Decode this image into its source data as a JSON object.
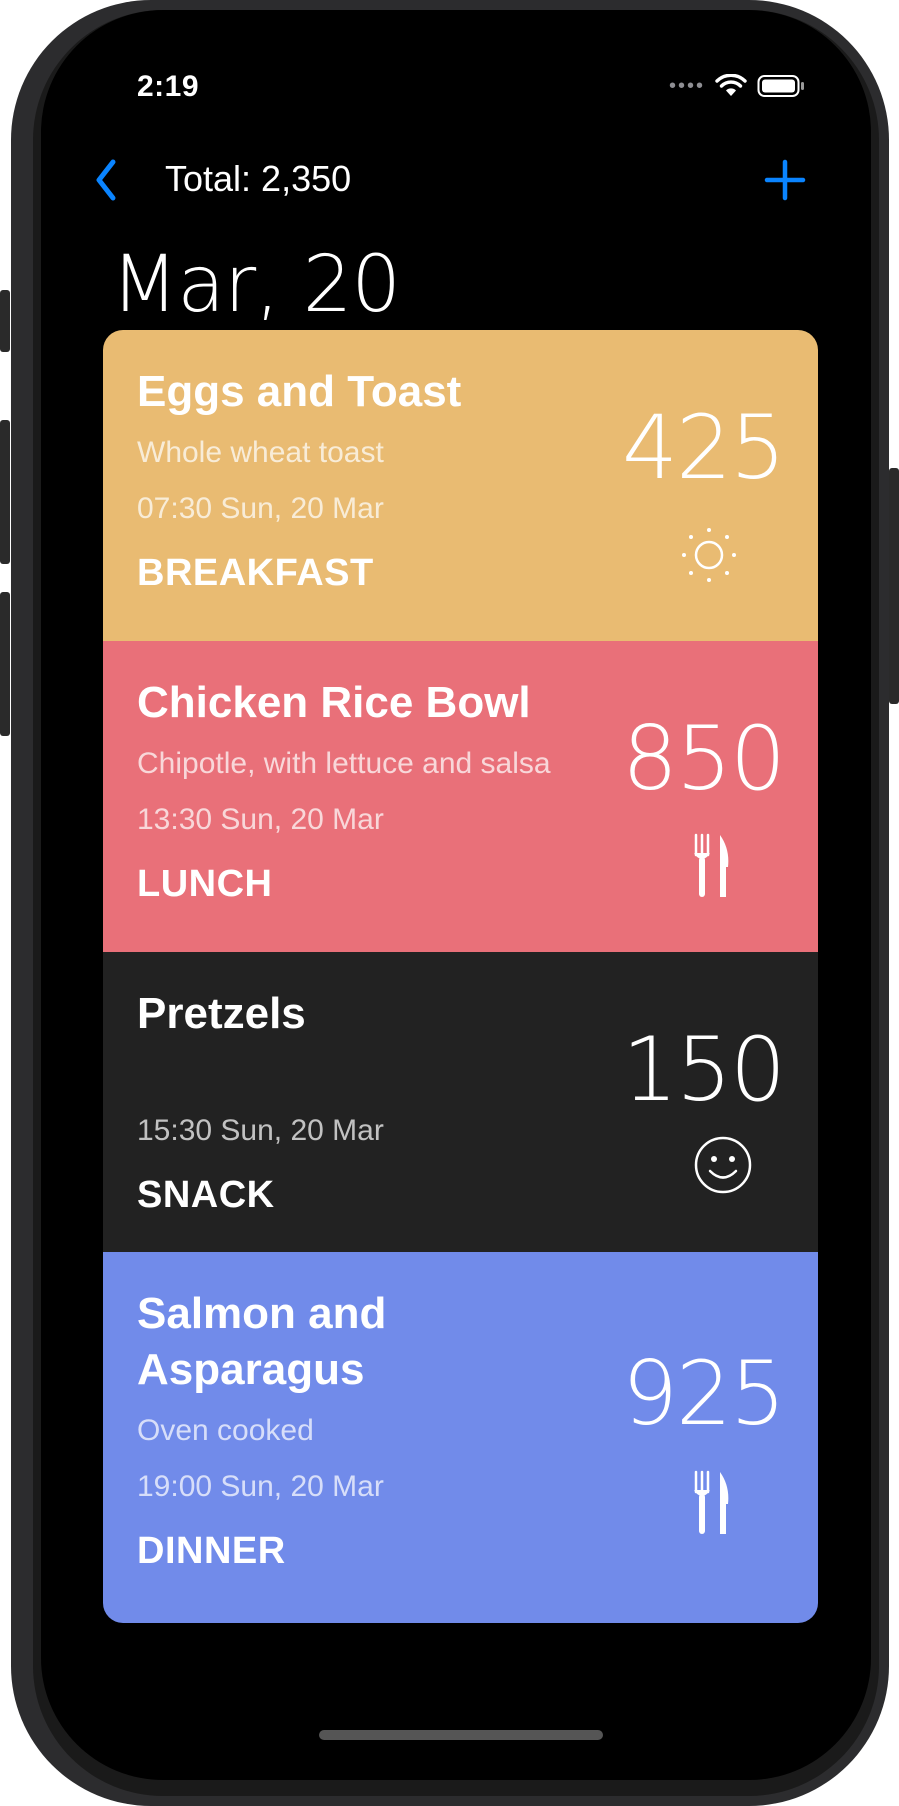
{
  "status": {
    "time": "2:19",
    "signal_dots": "••••"
  },
  "nav": {
    "title": "Total: 2,350",
    "back_icon": "chevron-left-icon",
    "add_icon": "plus-icon",
    "accent": "#0a84ff"
  },
  "date_title": "Mar, 20",
  "entries": [
    {
      "name": "Eggs and Toast",
      "description": "Whole wheat toast",
      "time": "07:30 Sun, 20 Mar",
      "kind": "BREAKFAST",
      "calories": "425",
      "icon": "sun-icon",
      "color": "#e9bb72"
    },
    {
      "name": "Chicken Rice Bowl",
      "description": "Chipotle, with lettuce and salsa",
      "time": "13:30 Sun, 20 Mar",
      "kind": "LUNCH",
      "calories": "850",
      "icon": "fork-knife-icon",
      "color": "#e97079"
    },
    {
      "name": "Pretzels",
      "description": "",
      "time": "15:30 Sun, 20 Mar",
      "kind": "SNACK",
      "calories": "150",
      "icon": "smiley-icon",
      "color": "#222222"
    },
    {
      "name": "Salmon and Asparagus",
      "description": "Oven cooked",
      "time": "19:00 Sun, 20 Mar",
      "kind": "DINNER",
      "calories": "925",
      "icon": "fork-knife-icon",
      "color": "#718bea"
    }
  ]
}
